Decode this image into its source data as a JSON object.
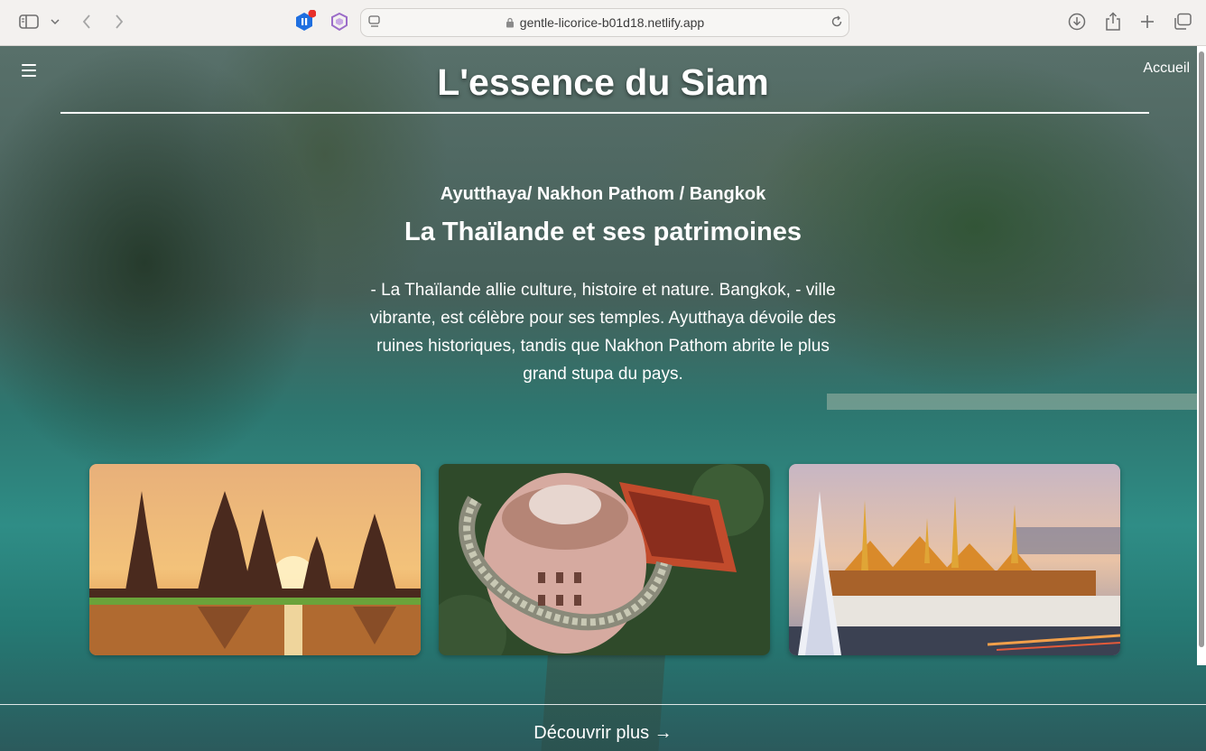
{
  "browser": {
    "url": "gentle-licorice-b01d18.netlify.app"
  },
  "page": {
    "site_title": "L'essence du Siam",
    "nav_home": "Accueil",
    "subhead": "Ayutthaya/ Nakhon Pathom / Bangkok",
    "heading": "La Thaïlande et ses patrimoines",
    "description": "- La Thaïlande allie culture, histoire et nature. Bangkok, - ville vibrante, est célèbre pour ses temples. Ayutthaya dévoile des ruines historiques, tandis que Nakhon Pathom abrite le plus grand stupa du pays.",
    "cta": "Découvrir plus →"
  },
  "icons": {
    "sidebar": "sidebar-icon",
    "back": "chevron-left-icon",
    "forward": "chevron-right-icon",
    "extension1": "pause-extension-icon",
    "extension2": "shield-extension-icon",
    "reader": "reader-icon",
    "lock": "lock-icon",
    "reload": "reload-icon",
    "download": "download-icon",
    "share": "share-icon",
    "new_tab": "plus-icon",
    "tabs": "tabs-overview-icon",
    "menu": "hamburger-menu-icon"
  },
  "colors": {
    "text": "#ffffff",
    "extension_blue": "#1f6fe0",
    "notification_red": "#e8302a",
    "extension_purple": "#9b6cc8"
  }
}
